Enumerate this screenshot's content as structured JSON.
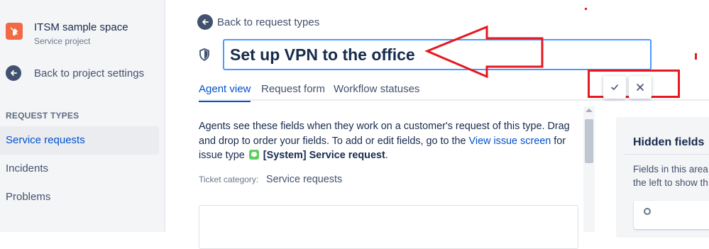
{
  "sidebar": {
    "project_name": "ITSM sample space",
    "project_type": "Service project",
    "back_label": "Back to project settings",
    "section_title": "REQUEST TYPES",
    "items": [
      {
        "label": "Service requests",
        "active": true
      },
      {
        "label": "Incidents",
        "active": false
      },
      {
        "label": "Problems",
        "active": false
      }
    ]
  },
  "main": {
    "back_label": "Back to request types",
    "title_value": "Set up VPN to the office",
    "tabs": [
      {
        "label": "Agent view",
        "active": true
      },
      {
        "label": "Request form",
        "active": false
      },
      {
        "label": "Workflow statuses",
        "active": false
      }
    ],
    "description": {
      "text1": "Agents see these fields when they work on a customer's request of this type. Drag and drop to order your fields. To add or edit fields, go to the ",
      "link": "View issue screen",
      "text2": " for issue type ",
      "issue_type": "[System] Service request",
      "text3": "."
    },
    "ticket_category_label": "Ticket category:",
    "ticket_category_value": "Service requests"
  },
  "hidden_fields": {
    "title": "Hidden fields",
    "desc_line1": "Fields in this area",
    "desc_line2": "the left to show th"
  },
  "icons": {
    "project": "wrench-icon",
    "back": "arrow-left-circle-icon",
    "request_type": "shield-icon",
    "confirm": "check-icon",
    "cancel": "close-icon"
  },
  "colors": {
    "accent": "#0052cc",
    "annotation_red": "#e5191f",
    "project_icon": "#f06a45",
    "issue_type_icon": "#5fd05f"
  }
}
